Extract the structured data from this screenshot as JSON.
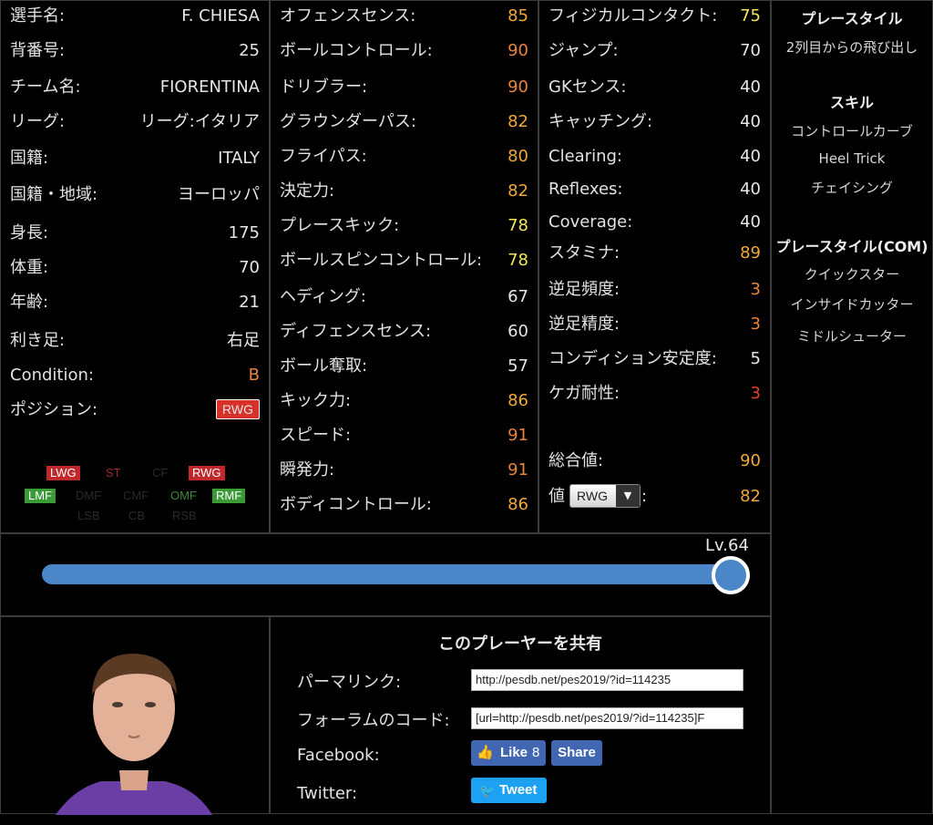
{
  "profile": [
    {
      "label": "選手名:",
      "value": "F. CHIESA"
    },
    {
      "label": "背番号:",
      "value": "25"
    },
    {
      "label": "チーム名:",
      "value": "FIORENTINA"
    },
    {
      "label": "リーグ:",
      "value": "リーグ:イタリア"
    },
    {
      "label": "国籍:",
      "value": "ITALY"
    },
    {
      "label": "国籍・地域:",
      "value": "ヨーロッパ"
    },
    {
      "label": "身長:",
      "value": "175"
    },
    {
      "label": "体重:",
      "value": "70"
    },
    {
      "label": "年齢:",
      "value": "21"
    },
    {
      "label": "利き足:",
      "value": "右足"
    },
    {
      "label": "Condition:",
      "value": "B"
    },
    {
      "label": "ポジション:",
      "value": "RWG"
    }
  ],
  "positions": {
    "row1": [
      "LWG",
      "ST",
      "CF",
      "RWG"
    ],
    "row2": [
      "LMF",
      "DMF",
      "CMF",
      "OMF",
      "RMF"
    ],
    "row3": [
      "LSB",
      "CB",
      "RSB"
    ]
  },
  "stats_col1": [
    {
      "label": "オフェンスセンス:",
      "value": "85"
    },
    {
      "label": "ボールコントロール:",
      "value": "90"
    },
    {
      "label": "ドリブラー:",
      "value": "90"
    },
    {
      "label": "グラウンダーパス:",
      "value": "82"
    },
    {
      "label": "フライパス:",
      "value": "80"
    },
    {
      "label": "決定力:",
      "value": "82"
    },
    {
      "label": "プレースキック:",
      "value": "78"
    },
    {
      "label": "ボールスピンコントロール:",
      "value": "78"
    },
    {
      "label": "ヘディング:",
      "value": "67"
    },
    {
      "label": "ディフェンスセンス:",
      "value": "60"
    },
    {
      "label": "ボール奪取:",
      "value": "57"
    },
    {
      "label": "キック力:",
      "value": "86"
    },
    {
      "label": "スピード:",
      "value": "91"
    },
    {
      "label": "瞬発力:",
      "value": "91"
    },
    {
      "label": "ボディコントロール:",
      "value": "86"
    }
  ],
  "stats_col2": [
    {
      "label": "フィジカルコンタクト:",
      "value": "75"
    },
    {
      "label": "ジャンプ:",
      "value": "70"
    },
    {
      "label": "GKセンス:",
      "value": "40"
    },
    {
      "label": "キャッチング:",
      "value": "40"
    },
    {
      "label": "Clearing:",
      "value": "40"
    },
    {
      "label": "Reflexes:",
      "value": "40"
    },
    {
      "label": "Coverage:",
      "value": "40"
    },
    {
      "label": "スタミナ:",
      "value": "89"
    },
    {
      "label": "逆足頻度:",
      "value": "3"
    },
    {
      "label": "逆足精度:",
      "value": "3"
    },
    {
      "label": "コンディション安定度:",
      "value": "5"
    },
    {
      "label": "ケガ耐性:",
      "value": "3"
    }
  ],
  "totals": {
    "overall_label": "総合値:",
    "overall_value": "90",
    "value_label": "値",
    "position_select": "RWG",
    "colon": ":",
    "value": "82"
  },
  "right": {
    "playstyle_title": "プレースタイル",
    "playstyle": "2列目からの飛び出し",
    "skills_title": "スキル",
    "skills": [
      "コントロールカーブ",
      "Heel Trick",
      "チェイシング"
    ],
    "com_title": "プレースタイル(COM)",
    "com": [
      "クイックスター",
      "インサイドカッター",
      "ミドルシューター"
    ]
  },
  "level": {
    "label": "Lv.64",
    "fraction": 1.0
  },
  "share": {
    "title": "このプレーヤーを共有",
    "permalink_label": "パーマリンク:",
    "permalink_value": "http://pesdb.net/pes2019/?id=114235",
    "forum_label": "フォーラムのコード:",
    "forum_value": "[url=http://pesdb.net/pes2019/?id=114235]F",
    "facebook_label": "Facebook:",
    "like_label": "Like",
    "like_count": "8",
    "share_label": "Share",
    "twitter_label": "Twitter:",
    "tweet_label": "Tweet"
  },
  "colors": {
    "bar": "#4a86c8",
    "yellow": "#f3e65a",
    "orange": "#f0a838",
    "red": "#e8402d",
    "badge": "#d6322a",
    "facebook": "#4267b2",
    "twitter": "#1da1f2"
  }
}
